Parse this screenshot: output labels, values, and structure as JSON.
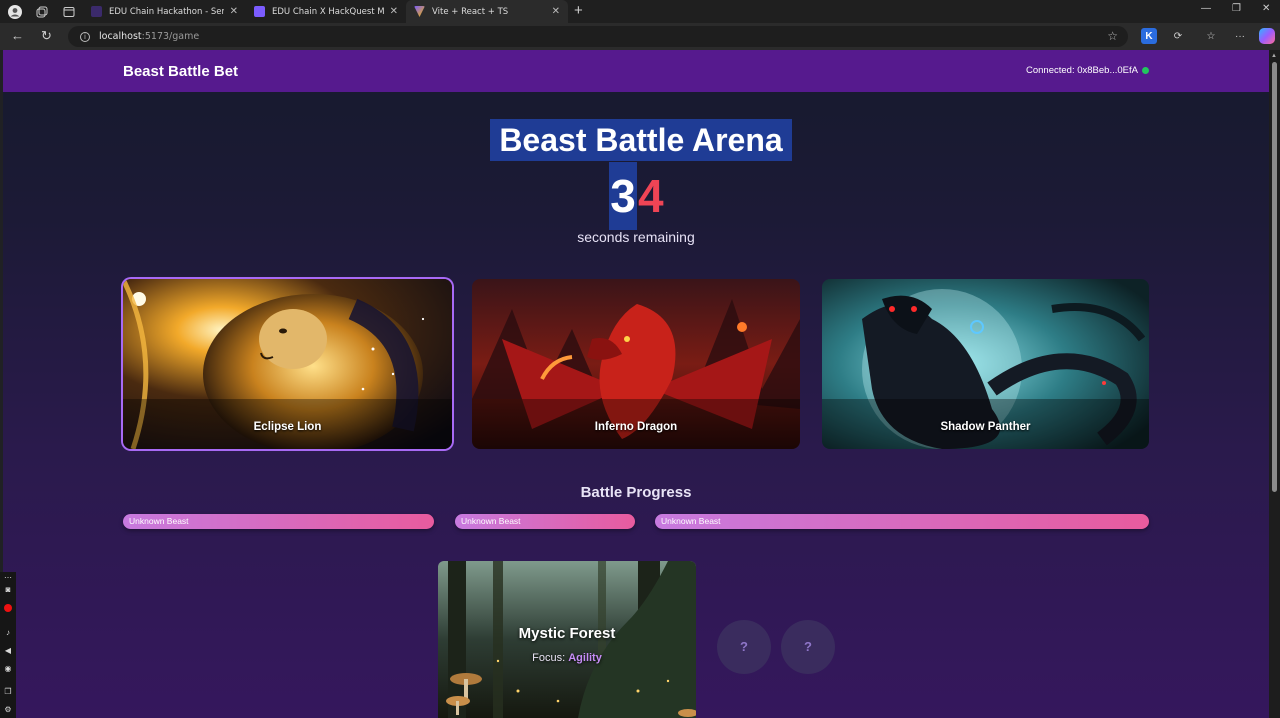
{
  "browser": {
    "tabs": [
      {
        "title": "EDU Chain Hackathon - Semester",
        "favicon_color": "#3b2a6b"
      },
      {
        "title": "EDU Chain X HackQuest Mega Co",
        "favicon_color": "#7b5cff"
      },
      {
        "title": "Vite + React + TS",
        "favicon_color": "#f5b700"
      }
    ],
    "url_host": "localhost",
    "url_path": ":5173/game"
  },
  "app": {
    "logo": "Beast Battle Bet",
    "connection": "Connected: 0x8Beb...0EfA",
    "connection_color": "#22c55e"
  },
  "arena": {
    "title": "Beast Battle Arena",
    "countdown_digit_1": "3",
    "countdown_digit_2": "4",
    "countdown_label": "seconds remaining"
  },
  "beasts": [
    {
      "name": "Eclipse Lion",
      "selected": true
    },
    {
      "name": "Inferno Dragon",
      "selected": false
    },
    {
      "name": "Shadow Panther",
      "selected": false
    }
  ],
  "battle_progress": {
    "title": "Battle Progress",
    "bars": [
      {
        "label": "Unknown Beast"
      },
      {
        "label": "Unknown Beast"
      },
      {
        "label": "Unknown Beast"
      }
    ]
  },
  "terrain": {
    "name": "Mystic Forest",
    "focus_label": "Focus:",
    "focus_value": "Agility",
    "hidden_slots": [
      "?",
      "?"
    ]
  }
}
